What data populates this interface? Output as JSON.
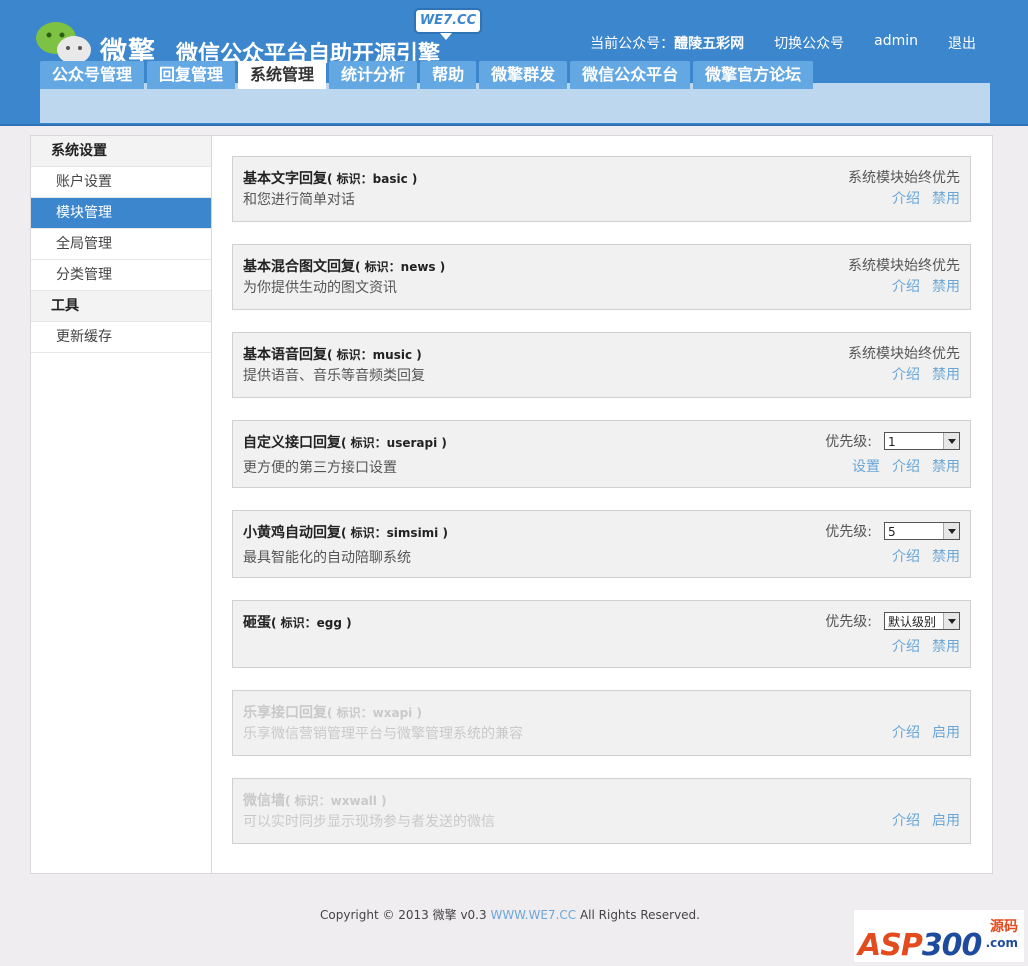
{
  "header": {
    "logo_text": "微擎",
    "logo_sub": "微信公众平台自助开源引擎",
    "badge": "WE7.CC",
    "current_account_label": "当前公众号：",
    "current_account": "醴陵五彩网",
    "switch_account": "切换公众号",
    "user": "admin",
    "logout": "退出",
    "tabs": [
      {
        "label": "公众号管理",
        "active": false
      },
      {
        "label": "回复管理",
        "active": false
      },
      {
        "label": "系统管理",
        "active": true
      },
      {
        "label": "统计分析",
        "active": false
      },
      {
        "label": "帮助",
        "active": false
      },
      {
        "label": "微擎群发",
        "active": false
      },
      {
        "label": "微信公众平台",
        "active": false
      },
      {
        "label": "微擎官方论坛",
        "active": false
      }
    ]
  },
  "sidebar": {
    "group1": "系统设置",
    "items1": [
      "账户设置",
      "模块管理",
      "全局管理",
      "分类管理"
    ],
    "group2": "工具",
    "items2": [
      "更新缓存"
    ]
  },
  "modules": [
    {
      "title": "基本文字回复",
      "id": "( 标识：basic )",
      "desc": "和您进行简单对话",
      "status": "系统模块始终优先",
      "links": [
        "介绍",
        "禁用"
      ]
    },
    {
      "title": "基本混合图文回复",
      "id": "( 标识：news )",
      "desc": "为你提供生动的图文资讯",
      "status": "系统模块始终优先",
      "links": [
        "介绍",
        "禁用"
      ]
    },
    {
      "title": "基本语音回复",
      "id": "( 标识：music )",
      "desc": "提供语音、音乐等音频类回复",
      "status": "系统模块始终优先",
      "links": [
        "介绍",
        "禁用"
      ]
    },
    {
      "title": "自定义接口回复",
      "id": "( 标识：userapi )",
      "desc": "更方便的第三方接口设置",
      "priority_label": "优先级:",
      "priority": "1",
      "links": [
        "设置",
        "介绍",
        "禁用"
      ]
    },
    {
      "title": "小黄鸡自动回复",
      "id": "( 标识：simsimi )",
      "desc": "最具智能化的自动陪聊系统",
      "priority_label": "优先级:",
      "priority": "5",
      "links": [
        "介绍",
        "禁用"
      ]
    },
    {
      "title": "砸蛋",
      "id": "( 标识：egg )",
      "desc": "",
      "priority_label": "优先级:",
      "priority": "默认级别",
      "links": [
        "介绍",
        "禁用"
      ]
    },
    {
      "title": "乐享接口回复",
      "id": "( 标识：wxapi )",
      "desc": "乐享微信营销管理平台与微擎管理系统的兼容",
      "links": [
        "介绍",
        "启用"
      ],
      "disabled": true
    },
    {
      "title": "微信墙",
      "id": "( 标识：wxwall )",
      "desc": "可以实时同步显示现场参与者发送的微信",
      "links": [
        "介绍",
        "启用"
      ],
      "disabled": true
    }
  ],
  "footer": {
    "prefix": "Copyright © 2013 微擎 v0.3 ",
    "link": "WWW.WE7.CC",
    "suffix": " All Rights Reserved."
  },
  "watermark": {
    "main_a": "ASP",
    "main_b": "300",
    "small1": "源码",
    "small2": ".com"
  }
}
